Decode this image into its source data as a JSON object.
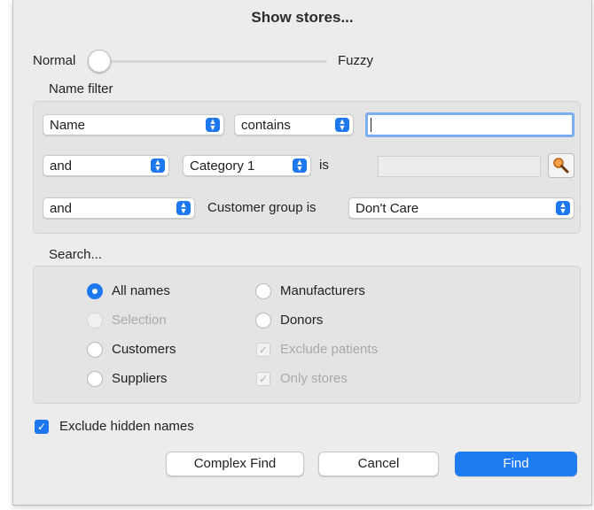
{
  "window": {
    "title": "Show stores..."
  },
  "match_slider": {
    "left_label": "Normal",
    "right_label": "Fuzzy",
    "value": 0
  },
  "name_filter": {
    "heading": "Name filter",
    "row1": {
      "field": "Name",
      "operator": "contains",
      "value": ""
    },
    "row2": {
      "conjunction": "and",
      "category": "Category 1",
      "is_label": "is",
      "value": ""
    },
    "row3": {
      "conjunction": "and",
      "label": "Customer group is",
      "value": "Don't Care"
    }
  },
  "search": {
    "heading": "Search...",
    "options": {
      "all_names": "All names",
      "selection": "Selection",
      "customers": "Customers",
      "suppliers": "Suppliers",
      "manufacturers": "Manufacturers",
      "donors": "Donors"
    },
    "selected": "All names",
    "exclude_patients": "Exclude patients",
    "only_stores": "Only stores"
  },
  "exclude_hidden": {
    "label": "Exclude hidden names",
    "checked": true
  },
  "buttons": {
    "complex_find": "Complex Find",
    "cancel": "Cancel",
    "find": "Find"
  },
  "colors": {
    "accent": "#1e7cf2",
    "focus_ring": "#7aaef1",
    "window_bg": "#ececec"
  },
  "icons": {
    "lookup": "magnifier-icon",
    "popup": "chevron-updown-icon",
    "check": "checkmark-icon"
  }
}
